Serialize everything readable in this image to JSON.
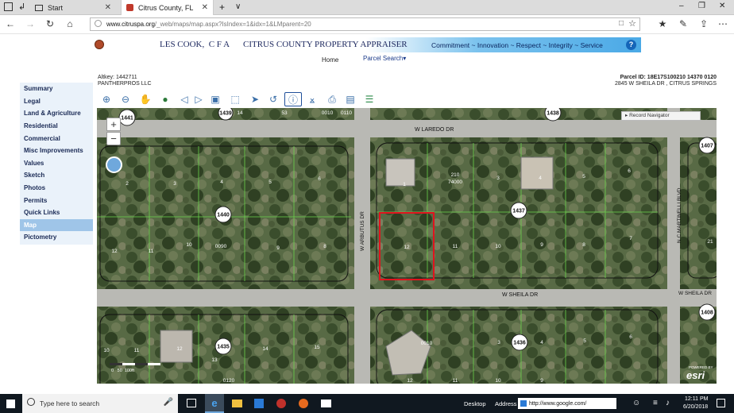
{
  "browser": {
    "tabs": [
      {
        "label": "Start"
      },
      {
        "label": "Citrus County, FL"
      }
    ],
    "url_prefix": "www.citruspa.org",
    "url_rest": "/_web/maps/map.aspx?IsIndex=1&idx=1&LMparent=20"
  },
  "site": {
    "appraiser_name": "LES COOK,  C F A",
    "office": "CITRUS COUNTY PROPERTY APPRAISER",
    "tagline": "Commitment ~ Innovation ~ Respect ~ Integrity ~ Service",
    "help": "?",
    "nav": {
      "home": "Home",
      "parcel_search": "Parcel Search▾"
    }
  },
  "parcel": {
    "altkey": "Altkey: 1442711",
    "owner": "PANTHERPROS LLC",
    "parcel_id": "Parcel ID: 18E17S100210 14370 0120",
    "address": "2845 W SHEILA DR , CITRUS SPRINGS"
  },
  "sidebar": {
    "items": [
      {
        "label": "Summary"
      },
      {
        "label": "Legal"
      },
      {
        "label": "Land & Agriculture"
      },
      {
        "label": "Residential"
      },
      {
        "label": "Commercial"
      },
      {
        "label": "Misc Improvements"
      },
      {
        "label": "Values"
      },
      {
        "label": "Sketch"
      },
      {
        "label": "Photos"
      },
      {
        "label": "Permits"
      },
      {
        "label": "Quick Links"
      },
      {
        "label": "Map"
      },
      {
        "label": "Pictometry"
      }
    ],
    "active": "Map"
  },
  "map": {
    "record_navigator": "▸ Record Navigator",
    "zoom_in": "+",
    "zoom_out": "−",
    "scale_label": "0   50  100ft",
    "esri_top": "POWERED BY",
    "esri": "esri",
    "streets": {
      "laredo": "W LAREDO DR",
      "sheila_main": "W SHEILA DR",
      "sheila_east": "W SHEILA DR",
      "arbutus": "W ARBUTUS DR",
      "martinelli": "N C MARTINELLI BLVD"
    },
    "block_labels": [
      "1441",
      "1439",
      "1438",
      "1407",
      "1440",
      "1437",
      "1435",
      "1436",
      "1408"
    ],
    "lot_labels": [
      "14",
      "53",
      "0010",
      "0110",
      "2",
      "3",
      "4",
      "5",
      "6",
      "12",
      "11",
      "10",
      "0090",
      "9",
      "8",
      "7",
      "1",
      "210",
      "74000",
      "3",
      "4",
      "5",
      "6",
      "12",
      "11",
      "10",
      "9",
      "8",
      "7",
      "21",
      "10",
      "11",
      "12",
      "13",
      "14",
      "15",
      "0010",
      "3",
      "4",
      "5",
      "6",
      "0120",
      "12",
      "11",
      "10",
      "9"
    ],
    "sel_lot": "12"
  },
  "taskbar": {
    "search_placeholder": "Type here to search",
    "desktop": "Desktop",
    "address_label": "Address",
    "address_value": "http://www.google.com/",
    "time": "12:11 PM",
    "date": "6/20/2018"
  },
  "colors": {
    "map_bg": "#5b6a48",
    "road": "#b9b9b4",
    "parcel_line": "#6bd44c",
    "selected_parcel": "#e0141e",
    "sidebar_bg": "#eaf2fa",
    "sidebar_active": "#9fc5e8",
    "header_blue": "#4aa9e6",
    "taskbar": "#101820"
  }
}
